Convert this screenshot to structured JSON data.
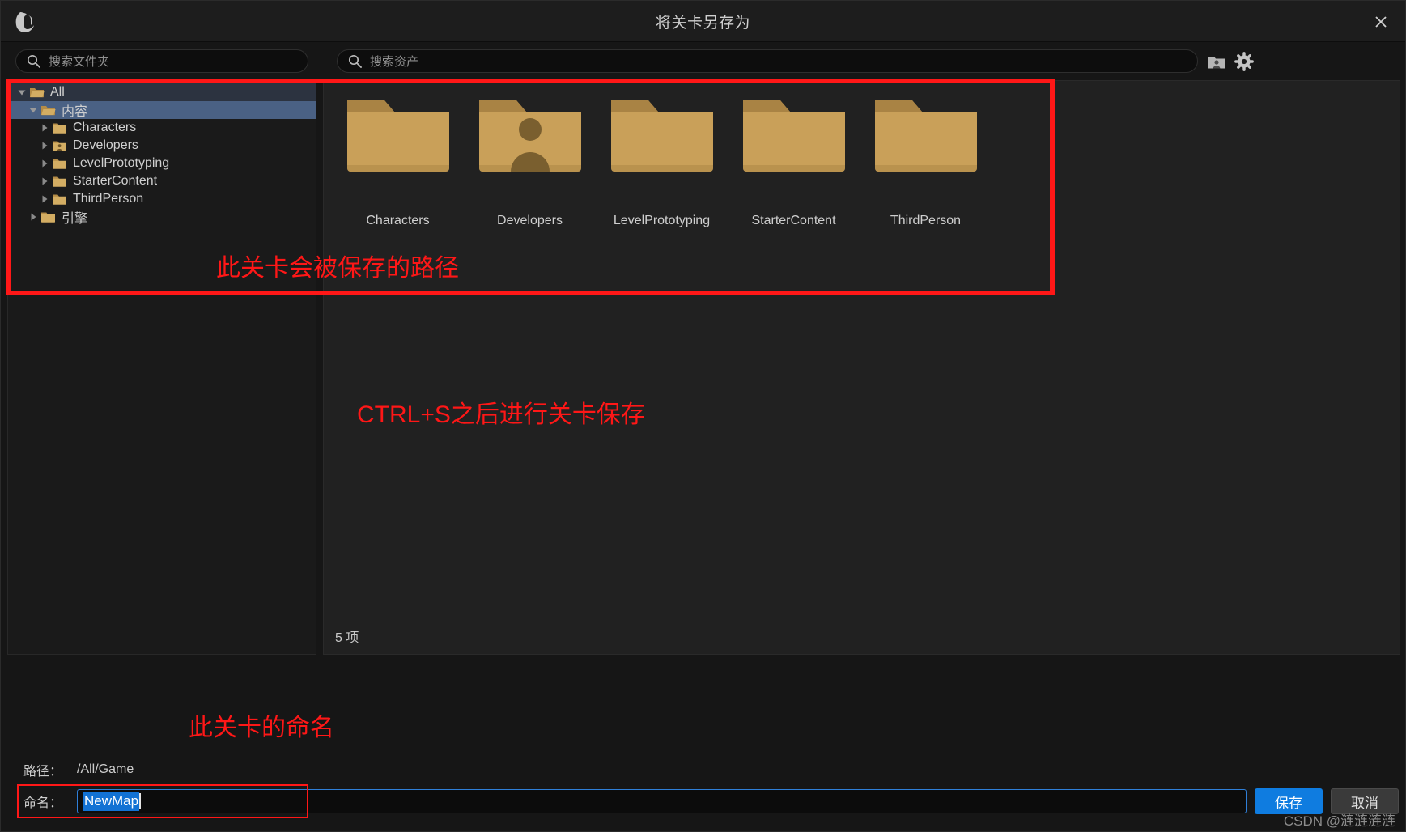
{
  "window": {
    "title": "将关卡另存为",
    "logo_icon": "unreal-engine-logo",
    "close_icon": "close-icon"
  },
  "toolbar": {
    "folder_search_placeholder": "搜索文件夹",
    "asset_search_placeholder": "搜索资产",
    "search_icon": "search-icon",
    "developers_folder_icon": "developers-folder-icon",
    "settings_icon": "gear-icon"
  },
  "tree": {
    "items": [
      {
        "label": "All",
        "depth": 0,
        "expanded": true,
        "state": "soft-selected",
        "icon": "folder-open-icon"
      },
      {
        "label": "内容",
        "depth": 1,
        "expanded": true,
        "state": "selected",
        "icon": "folder-open-icon"
      },
      {
        "label": "Characters",
        "depth": 2,
        "expanded": false,
        "state": "normal",
        "icon": "folder-icon"
      },
      {
        "label": "Developers",
        "depth": 2,
        "expanded": false,
        "state": "normal",
        "icon": "developers-folder-icon"
      },
      {
        "label": "LevelPrototyping",
        "depth": 2,
        "expanded": false,
        "state": "normal",
        "icon": "folder-icon"
      },
      {
        "label": "StarterContent",
        "depth": 2,
        "expanded": false,
        "state": "normal",
        "icon": "folder-icon"
      },
      {
        "label": "ThirdPerson",
        "depth": 2,
        "expanded": false,
        "state": "normal",
        "icon": "folder-icon"
      },
      {
        "label": "引擎",
        "depth": 1,
        "expanded": false,
        "state": "normal",
        "icon": "folder-icon"
      }
    ]
  },
  "content": {
    "folders": [
      {
        "label": "Characters",
        "icon": "folder-icon"
      },
      {
        "label": "Developers",
        "icon": "developers-folder-icon"
      },
      {
        "label": "LevelPrototyping",
        "icon": "folder-icon"
      },
      {
        "label": "StarterContent",
        "icon": "folder-icon"
      },
      {
        "label": "ThirdPerson",
        "icon": "folder-icon"
      }
    ],
    "item_count": "5 项"
  },
  "footer": {
    "path_label": "路径：",
    "path_value": "/All/Game",
    "name_label": "命名：",
    "name_value": "NewMap",
    "save_label": "保存",
    "cancel_label": "取消"
  },
  "annotations": {
    "path_note": "此关卡会被保存的路径",
    "ctrls_note": "CTRL+S之后进行关卡保存",
    "naming_note": "此关卡的命名",
    "color": "#ff1717"
  },
  "watermark": "CSDN @涟涟涟涟"
}
